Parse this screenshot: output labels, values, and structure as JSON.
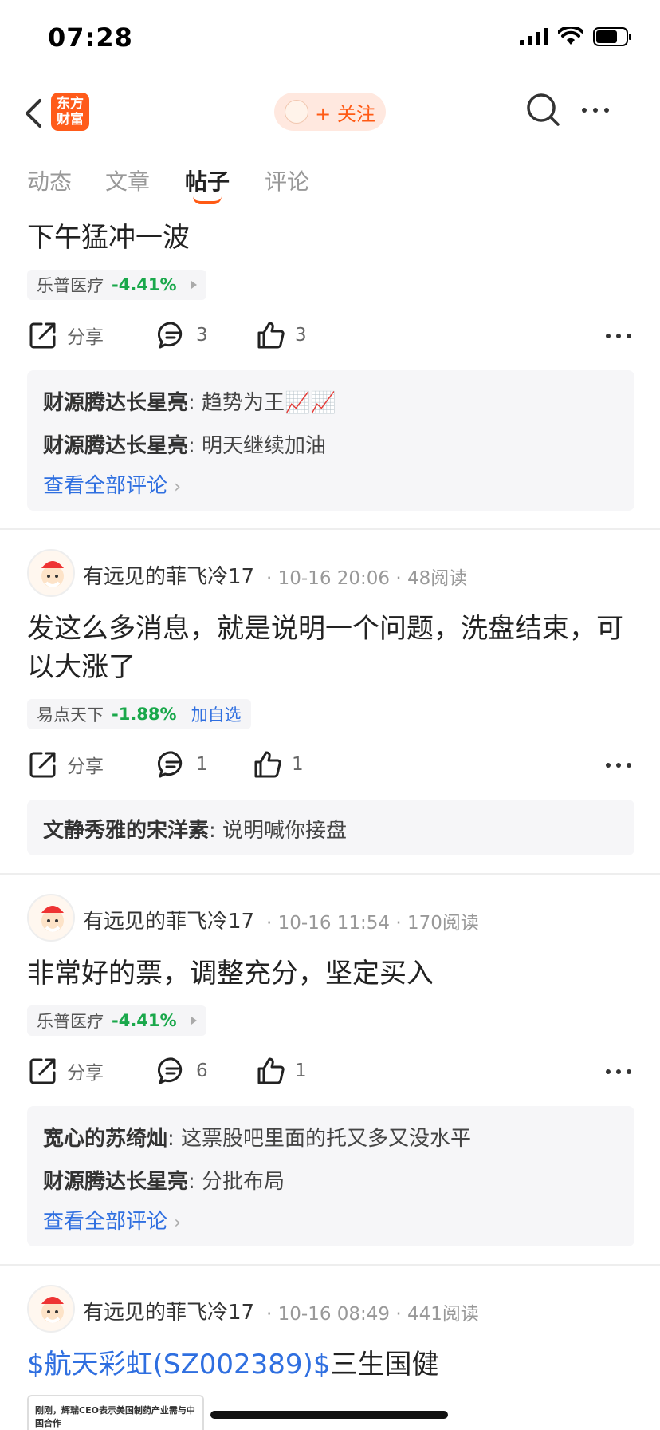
{
  "status": {
    "time": "07:28"
  },
  "header": {
    "logo_text": "东方财富",
    "follow_label": "+ 关注"
  },
  "tabs": [
    {
      "label": "动态"
    },
    {
      "label": "文章"
    },
    {
      "label": "帖子"
    },
    {
      "label": "评论"
    }
  ],
  "post1": {
    "content": "下午猛冲一波",
    "stock_name": "乐普医疗",
    "stock_change": "-4.41%",
    "share_label": "分享",
    "comment_count": "3",
    "like_count": "3",
    "comments": [
      {
        "user": "财源腾达长星亮",
        "sep": ":",
        "text": "趋势为王📈📈"
      },
      {
        "user": "财源腾达长星亮",
        "sep": ":",
        "text": "明天继续加油"
      }
    ],
    "see_all": "查看全部评论"
  },
  "post2": {
    "author": "有远见的菲飞冷17",
    "meta": "· 10-16 20:06 · 48阅读",
    "content": "发这么多消息，就是说明一个问题，洗盘结束，可以大涨了",
    "stock_name": "易点天下",
    "stock_change": "-1.88%",
    "stock_add": "加自选",
    "share_label": "分享",
    "comment_count": "1",
    "like_count": "1",
    "comments": [
      {
        "user": "文静秀雅的宋洋素",
        "sep": ":",
        "text": "说明喊你接盘"
      }
    ]
  },
  "post3": {
    "author": "有远见的菲飞冷17",
    "meta": "· 10-16 11:54 · 170阅读",
    "content": "非常好的票，调整充分，坚定买入",
    "stock_name": "乐普医疗",
    "stock_change": "-4.41%",
    "share_label": "分享",
    "comment_count": "6",
    "like_count": "1",
    "comments": [
      {
        "user": "宽心的苏绮灿",
        "sep": ":",
        "text": "这票股吧里面的托又多又没水平"
      },
      {
        "user": "财源腾达长星亮",
        "sep": ":",
        "text": "分批布局"
      }
    ],
    "see_all": "查看全部评论"
  },
  "post4": {
    "author": "有远见的菲飞冷17",
    "meta": "· 10-16 08:49 · 441阅读",
    "content_link": "$航天彩虹(SZ002389)$",
    "content_rest": "三生国健",
    "news_title": "刚刚，辉瑞CEO表示美国制药产业需与中国合作"
  }
}
